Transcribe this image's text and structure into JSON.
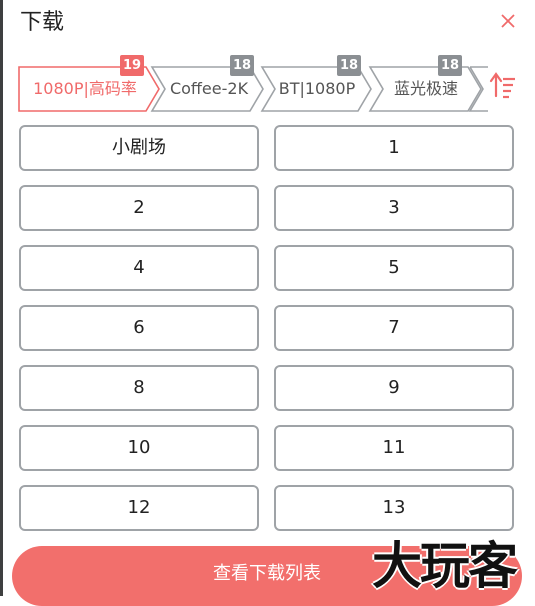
{
  "header": {
    "title": "下载"
  },
  "icons": {
    "close": "close-icon",
    "sort": "sort-descending-icon"
  },
  "colors": {
    "accent": "#f06a6a",
    "badge": "#8b8f93",
    "border": "#9fa3a7",
    "footer": "#f26f6c"
  },
  "tabs": [
    {
      "label": "1080P|高码率",
      "badge": "19",
      "active": true
    },
    {
      "label": "Coffee-2K",
      "badge": "18",
      "active": false
    },
    {
      "label": "BT|1080P",
      "badge": "18",
      "active": false
    },
    {
      "label": "蓝光极速",
      "badge": "18",
      "active": false
    }
  ],
  "episodes": [
    "小剧场",
    "1",
    "2",
    "3",
    "4",
    "5",
    "6",
    "7",
    "8",
    "9",
    "10",
    "11",
    "12",
    "13"
  ],
  "footer": {
    "button_label": "查看下载列表"
  },
  "watermark": {
    "text": "大玩客"
  }
}
